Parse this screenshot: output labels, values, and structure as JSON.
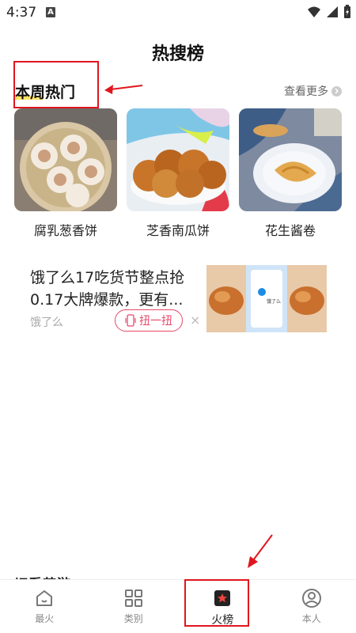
{
  "status": {
    "time": "4:37",
    "badge": "A"
  },
  "page": {
    "title": "热搜榜"
  },
  "section": {
    "title": "本周热门",
    "more": "查看更多"
  },
  "cards": [
    {
      "label": "腐乳葱香饼"
    },
    {
      "label": "芝香南瓜饼"
    },
    {
      "label": "花生酱卷"
    }
  ],
  "ad": {
    "text": "饿了么17吃货节整点抢0.17大牌爆款，更有...",
    "source": "饿了么",
    "button": "扭一扭",
    "close": "×",
    "image_caption": "饿了么"
  },
  "peek": {
    "text": "一切看茶游"
  },
  "nav": [
    {
      "label": "最火"
    },
    {
      "label": "类别"
    },
    {
      "label": "火榜"
    },
    {
      "label": "本人"
    }
  ],
  "colors": {
    "annotation": "#e0161e",
    "accent": "#e84a6a",
    "nav_active_star": "#e8453c"
  }
}
